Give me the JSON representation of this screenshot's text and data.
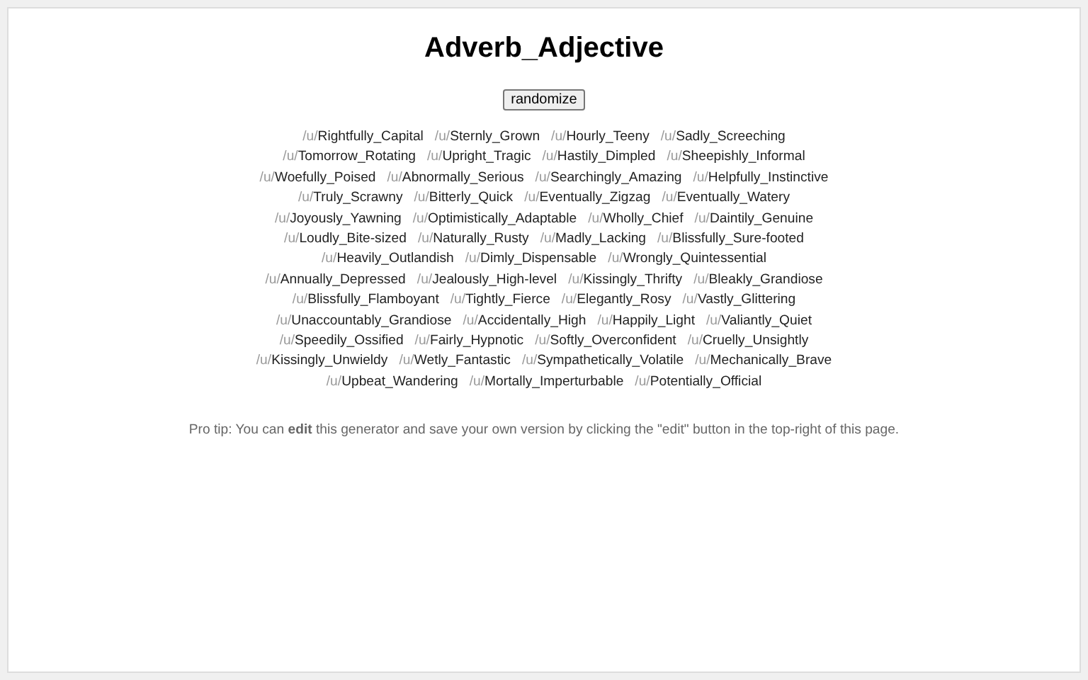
{
  "title": "Adverb_Adjective",
  "button": "randomize",
  "rows": [
    [
      {
        "prefix": "/u/",
        "name": "Rightfully_Capital"
      },
      {
        "prefix": "/u/",
        "name": "Sternly_Grown"
      },
      {
        "prefix": "/u/",
        "name": "Hourly_Teeny"
      },
      {
        "prefix": "/u/",
        "name": "Sadly_Screeching"
      }
    ],
    [
      {
        "prefix": "/u/",
        "name": "Tomorrow_Rotating"
      },
      {
        "prefix": "/u/",
        "name": "Upright_Tragic"
      },
      {
        "prefix": "/u/",
        "name": "Hastily_Dimpled"
      },
      {
        "prefix": "/u/",
        "name": "Sheepishly_Informal"
      }
    ],
    [
      {
        "prefix": "/u/",
        "name": "Woefully_Poised"
      },
      {
        "prefix": "/u/",
        "name": "Abnormally_Serious"
      },
      {
        "prefix": "/u/",
        "name": "Searchingly_Amazing"
      },
      {
        "prefix": "/u/",
        "name": "Helpfully_Instinctive"
      }
    ],
    [
      {
        "prefix": "/u/",
        "name": "Truly_Scrawny"
      },
      {
        "prefix": "/u/",
        "name": "Bitterly_Quick"
      },
      {
        "prefix": "/u/",
        "name": "Eventually_Zigzag"
      },
      {
        "prefix": "/u/",
        "name": "Eventually_Watery"
      }
    ],
    [
      {
        "prefix": "/u/",
        "name": "Joyously_Yawning"
      },
      {
        "prefix": "/u/",
        "name": "Optimistically_Adaptable"
      },
      {
        "prefix": "/u/",
        "name": "Wholly_Chief"
      },
      {
        "prefix": "/u/",
        "name": "Daintily_Genuine"
      }
    ],
    [
      {
        "prefix": "/u/",
        "name": "Loudly_Bite-sized"
      },
      {
        "prefix": "/u/",
        "name": "Naturally_Rusty"
      },
      {
        "prefix": "/u/",
        "name": "Madly_Lacking"
      },
      {
        "prefix": "/u/",
        "name": "Blissfully_Sure-footed"
      }
    ],
    [
      {
        "prefix": "/u/",
        "name": "Heavily_Outlandish"
      },
      {
        "prefix": "/u/",
        "name": "Dimly_Dispensable"
      },
      {
        "prefix": "/u/",
        "name": "Wrongly_Quintessential"
      }
    ],
    [
      {
        "prefix": "/u/",
        "name": "Annually_Depressed"
      },
      {
        "prefix": "/u/",
        "name": "Jealously_High-level"
      },
      {
        "prefix": "/u/",
        "name": "Kissingly_Thrifty"
      },
      {
        "prefix": "/u/",
        "name": "Bleakly_Grandiose"
      }
    ],
    [
      {
        "prefix": "/u/",
        "name": "Blissfully_Flamboyant"
      },
      {
        "prefix": "/u/",
        "name": "Tightly_Fierce"
      },
      {
        "prefix": "/u/",
        "name": "Elegantly_Rosy"
      },
      {
        "prefix": "/u/",
        "name": "Vastly_Glittering"
      }
    ],
    [
      {
        "prefix": "/u/",
        "name": "Unaccountably_Grandiose"
      },
      {
        "prefix": "/u/",
        "name": "Accidentally_High"
      },
      {
        "prefix": "/u/",
        "name": "Happily_Light"
      },
      {
        "prefix": "/u/",
        "name": "Valiantly_Quiet"
      }
    ],
    [
      {
        "prefix": "/u/",
        "name": "Speedily_Ossified"
      },
      {
        "prefix": "/u/",
        "name": "Fairly_Hypnotic"
      },
      {
        "prefix": "/u/",
        "name": "Softly_Overconfident"
      },
      {
        "prefix": "/u/",
        "name": "Cruelly_Unsightly"
      }
    ],
    [
      {
        "prefix": "/u/",
        "name": "Kissingly_Unwieldy"
      },
      {
        "prefix": "/u/",
        "name": "Wetly_Fantastic"
      },
      {
        "prefix": "/u/",
        "name": "Sympathetically_Volatile"
      },
      {
        "prefix": "/u/",
        "name": "Mechanically_Brave"
      }
    ],
    [
      {
        "prefix": "/u/",
        "name": "Upbeat_Wandering"
      },
      {
        "prefix": "/u/",
        "name": "Mortally_Imperturbable"
      },
      {
        "prefix": "/u/",
        "name": "Potentially_Official"
      }
    ]
  ],
  "tip": "Pro tip: You can **edit** this generator and save your own version by clicking the \"edit\" button in the top-right of this page."
}
